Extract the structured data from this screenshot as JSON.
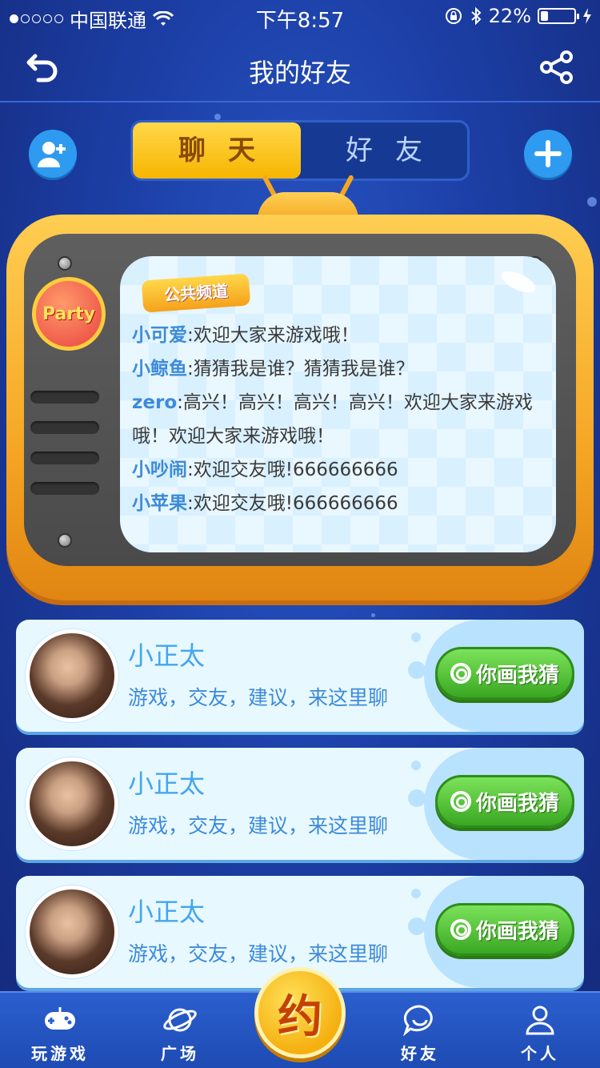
{
  "status_bar": {
    "carrier": "中国联通",
    "time": "下午8:57",
    "battery_text": "22%",
    "battery_level": 0.22
  },
  "header": {
    "title": "我的好友",
    "back_icon": "back-arrow-icon",
    "share_icon": "share-icon"
  },
  "segment": {
    "tabs": [
      {
        "label": "聊天",
        "active": true
      },
      {
        "label": "好友",
        "active": false
      }
    ]
  },
  "channel": {
    "badge": "Party",
    "tag": "公共频道",
    "messages": [
      {
        "name": "小可爱",
        "text": ":欢迎大家来游戏哦！"
      },
      {
        "name": "小鲸鱼",
        "text": ":猜猜我是谁？猜猜我是谁？"
      },
      {
        "name": "zero",
        "text": ":高兴！高兴！高兴！高兴！欢迎大家来游戏哦！欢迎大家来游戏哦！"
      },
      {
        "name": "小吵闹",
        "text": ":欢迎交友哦!666666666"
      },
      {
        "name": "小苹果",
        "text": ":欢迎交友哦!666666666"
      }
    ]
  },
  "friends": [
    {
      "name": "小正太",
      "desc": "游戏，交友，建议，来这里聊",
      "button": "你画我猜"
    },
    {
      "name": "小正太",
      "desc": "游戏，交友，建议，来这里聊",
      "button": "你画我猜"
    },
    {
      "name": "小正太",
      "desc": "游戏，交友，建议，来这里聊",
      "button": "你画我猜"
    }
  ],
  "bottom_nav": {
    "items": [
      {
        "label": "玩游戏",
        "icon": "gamepad-icon"
      },
      {
        "label": "广场",
        "icon": "planet-icon"
      },
      {
        "label": "好友",
        "icon": "chat-bubble-icon"
      },
      {
        "label": "个人",
        "icon": "person-icon"
      }
    ],
    "center": "约"
  },
  "colors": {
    "background": "#1c3fa6",
    "accent_yellow": "#f7b500",
    "button_green": "#3aa722",
    "name_blue": "#3d8bd9"
  }
}
